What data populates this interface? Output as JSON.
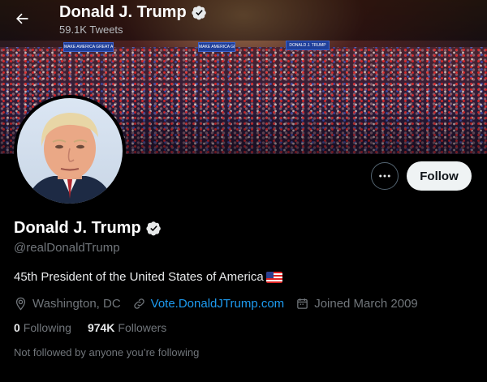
{
  "header": {
    "name": "Donald J. Trump",
    "tweet_count": "59.1K Tweets"
  },
  "banner": {
    "signs": [
      "MAKE AMERICA GREAT AGAIN!",
      "MAKE AMERICA GREAT AGAIN!",
      "DONALD J. TRUMP"
    ]
  },
  "profile": {
    "name": "Donald J. Trump",
    "handle": "@realDonaldTrump",
    "bio": "45th President of the United States of America",
    "location": "Washington, DC",
    "website": "Vote.DonaldJTrump.com",
    "joined": "Joined March 2009",
    "following_count": "0",
    "following_label": "Following",
    "followers_count": "974K",
    "followers_label": "Followers",
    "not_followed_text": "Not followed by anyone you’re following"
  },
  "actions": {
    "follow_label": "Follow"
  },
  "colors": {
    "accent": "#1d9bf0",
    "background": "#000000",
    "secondary_text": "#71767b"
  },
  "icons": {
    "back": "arrow-left-icon",
    "verified": "verified-badge-icon",
    "more": "more-horizontal-icon",
    "location": "location-pin-icon",
    "link": "link-icon",
    "calendar": "calendar-icon",
    "flag": "us-flag-icon"
  }
}
